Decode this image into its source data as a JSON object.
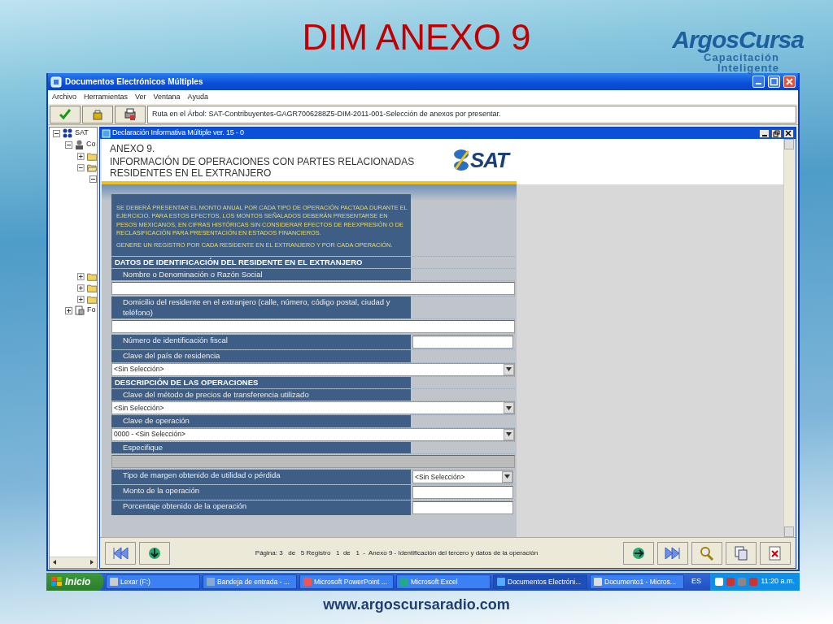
{
  "slide": {
    "title": "DIM ANEXO 9",
    "logo": {
      "name": "ArgosCursa",
      "tagline": "Capacitación",
      "tagline_2": "Inteligente"
    },
    "footer_url": "www.argoscursaradio.com"
  },
  "window": {
    "title": "Documentos Electrónicos Múltiples"
  },
  "menu": [
    "Archivo",
    "Herramientas",
    "Ver",
    "Ventana",
    "Ayuda"
  ],
  "path": "Ruta en el Árbol: SAT-Contribuyentes-GAGR7006288Z5-DIM-2011-001-Selección de anexos por presentar.",
  "tree": [
    {
      "label": "SAT",
      "kind": "root",
      "expanded": true,
      "children": [
        {
          "label": "Co",
          "kind": "person",
          "expanded": true,
          "children": [
            {
              "kind": "folder",
              "expanded": false
            },
            {
              "kind": "folder",
              "expanded": true,
              "children": [
                {
                  "kind": "node",
                  "expanded": true
                }
              ]
            },
            {
              "kind": "folder",
              "expanded": false
            },
            {
              "kind": "folder",
              "expanded": false
            },
            {
              "kind": "folder",
              "expanded": false
            }
          ]
        },
        {
          "label": "Fo",
          "kind": "form",
          "expanded": false
        }
      ]
    }
  ],
  "child_window": {
    "title": "Declaración Informativa Múltiple ver. 15 - 0"
  },
  "form": {
    "heading": "ANEXO 9.",
    "subheading": "INFORMACIÓN DE OPERACIONES CON PARTES RELACIONADAS RESIDENTES EN EL EXTRANJERO",
    "logo_text": "SAT",
    "notes": [
      "SE DEBERÁ PRESENTAR EL MONTO ANUAL POR CADA TIPO DE OPERACIÓN PACTADA DURANTE EL EJERCICIO. PARA ESTOS EFECTOS, LOS MONTOS SEÑALADOS DEBERÁN PRESENTARSE EN PESOS MEXICANOS, EN CIFRAS HISTÓRICAS SIN CONSIDERAR EFECTOS DE REEXPRESIÓN O DE RECLASIFICACIÓN PARA PRESENTACIÓN EN ESTADOS FINANCIEROS.",
      "GENERE UN REGISTRO POR CADA RESIDENTE EN EL EXTRANJERO Y POR CADA OPERACIÓN."
    ],
    "rows": [
      {
        "kind": "section",
        "label": "DATOS DE IDENTIFICACIÓN DEL RESIDENTE EN EL EXTRANJERO"
      },
      {
        "kind": "label",
        "label": "Nombre o Denominación o Razón Social"
      },
      {
        "kind": "input",
        "disabled": false
      },
      {
        "kind": "label",
        "label": "Domicilio del residente en el extranjero (calle, número, código postal, ciudad y teléfono)"
      },
      {
        "kind": "input",
        "disabled": false
      },
      {
        "kind": "label_input",
        "label": "Número de identificación fiscal"
      },
      {
        "kind": "label",
        "label": "Clave del país de residencia"
      },
      {
        "kind": "select",
        "value": "<Sin Selección>"
      },
      {
        "kind": "section",
        "label": "DESCRIPCIÓN DE LAS OPERACIONES"
      },
      {
        "kind": "label",
        "label": "Clave del método de precios de transferencia utilizado"
      },
      {
        "kind": "select",
        "value": "<Sin Selección>"
      },
      {
        "kind": "label",
        "label": "Clave de operación"
      },
      {
        "kind": "select",
        "value": "0000 - <Sin Selección>"
      },
      {
        "kind": "label",
        "label": "Especifique"
      },
      {
        "kind": "input",
        "disabled": true
      },
      {
        "kind": "label_select",
        "label": "Tipo de margen obtenido de utilidad o pérdida",
        "value": "<Sin Selección>"
      },
      {
        "kind": "label_input",
        "label": "Monto de la operación"
      },
      {
        "kind": "label_input",
        "label": "Porcentaje obtenido de la operación"
      }
    ]
  },
  "status": "Página: 3   de   5 Registro   1  de   1  -  Anexo 9 - Identificación del tercero y datos de la operación",
  "taskbar": {
    "start": "Inicio",
    "tasks": [
      {
        "label": "Lexar (F:)",
        "selected": false
      },
      {
        "label": "Bandeja de entrada - ...",
        "selected": false
      },
      {
        "label": "Microsoft PowerPoint ...",
        "selected": false
      },
      {
        "label": "Microsoft Excel",
        "selected": false
      },
      {
        "label": "Documentos Electróni...",
        "selected": true
      },
      {
        "label": "Documento1 - Micros...",
        "selected": false
      }
    ],
    "language": "ES",
    "clock": "11:20 a.m."
  }
}
